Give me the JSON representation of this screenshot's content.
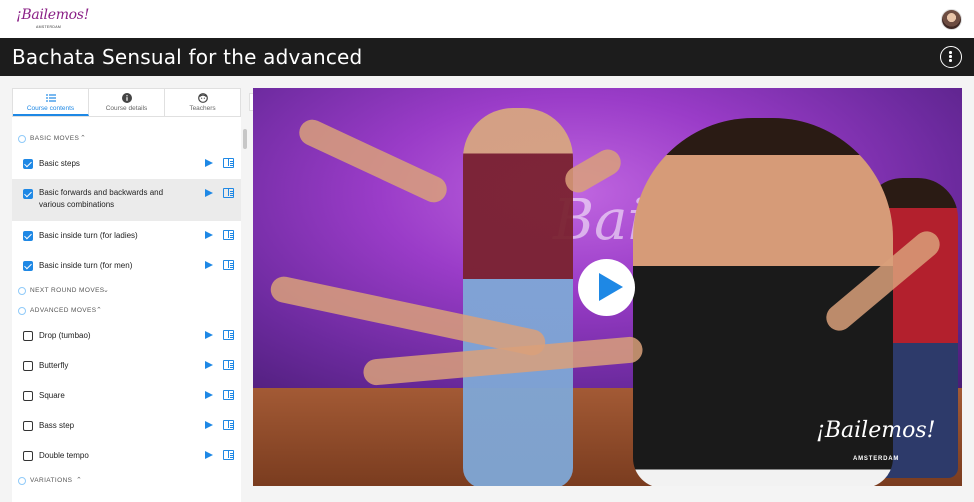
{
  "header": {
    "logo_text": "¡Bailemos!",
    "logo_sub": "AMSTERDAM"
  },
  "course": {
    "title": "Bachata Sensual for the advanced"
  },
  "tabs": [
    {
      "label": "Course contents",
      "icon": "list-icon",
      "active": true
    },
    {
      "label": "Course details",
      "icon": "info-icon",
      "active": false
    },
    {
      "label": "Teachers",
      "icon": "face-icon",
      "active": false
    }
  ],
  "sections": [
    {
      "label": "BASIC MOVES",
      "expanded": true
    },
    {
      "label": "NEXT ROUND MOVES",
      "expanded": false
    },
    {
      "label": "ADVANCED MOVES",
      "expanded": true
    },
    {
      "label": "VARIATIONS",
      "expanded": true
    }
  ],
  "items": [
    {
      "label": "Basic steps",
      "checked": true
    },
    {
      "label": "Basic forwards and backwards and various combinations",
      "checked": true
    },
    {
      "label": "Basic inside turn (for ladies)",
      "checked": true
    },
    {
      "label": "Basic inside turn (for men)",
      "checked": true
    },
    {
      "label": "Drop (tumbao)",
      "checked": false
    },
    {
      "label": "Butterfly",
      "checked": false
    },
    {
      "label": "Square",
      "checked": false
    },
    {
      "label": "Bass step",
      "checked": false
    },
    {
      "label": "Double tempo",
      "checked": false
    }
  ],
  "collapse_label": "«",
  "video": {
    "watermark_big": "Bailemos",
    "watermark_small": "¡Bailemos!",
    "watermark_small_sub": "AMSTERDAM"
  },
  "colors": {
    "accent": "#1e88e5",
    "titlebar": "#1c1c1c",
    "brand": "#8a1f86"
  }
}
